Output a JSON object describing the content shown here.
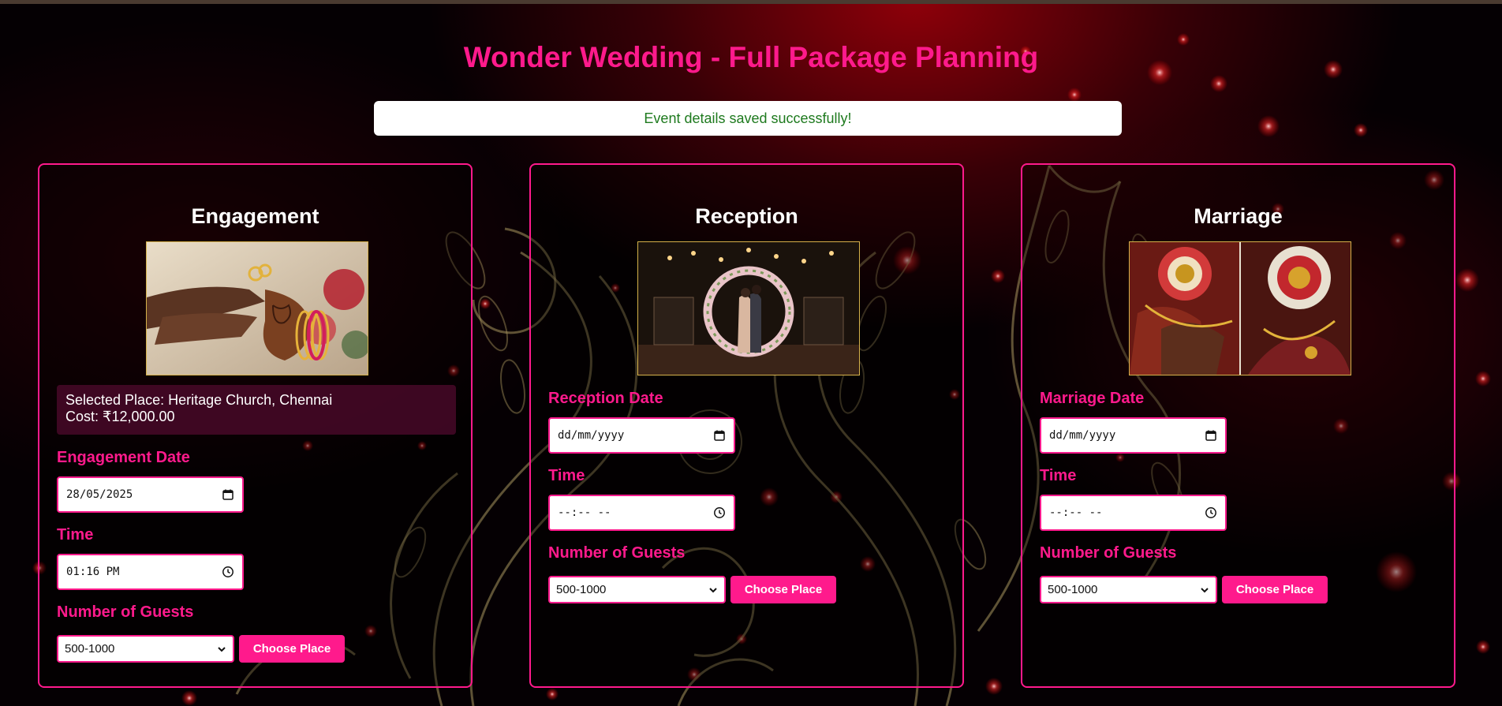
{
  "page": {
    "title": "Wonder Wedding - Full Package Planning",
    "status_message": "Event details saved successfully!"
  },
  "colors": {
    "accent": "#ff1a8c",
    "success_text": "#1e7a1e",
    "photo_border": "#d4b14a"
  },
  "icons": {
    "date_field": "calendar-icon",
    "time_field": "clock-icon",
    "select": "chevron-down-icon"
  },
  "events": [
    {
      "title": "Engagement",
      "selected_place": "Selected Place: Heritage Church, Chennai",
      "cost": "Cost: ₹12,000.00",
      "date_label": "Engagement Date",
      "date_value": "28/05/2025",
      "time_label": "Time",
      "time_value": "01:16 PM",
      "guests_label": "Number of Guests",
      "guests_value": "500-1000",
      "button_label": "Choose Place"
    },
    {
      "title": "Reception",
      "date_label": "Reception Date",
      "date_value": "dd/mm/yyyy",
      "time_label": "Time",
      "time_value": "--:-- --",
      "guests_label": "Number of Guests",
      "guests_value": "500-1000",
      "button_label": "Choose Place"
    },
    {
      "title": "Marriage",
      "date_label": "Marriage Date",
      "date_value": "dd/mm/yyyy",
      "time_label": "Time",
      "time_value": "--:-- --",
      "guests_label": "Number of Guests",
      "guests_value": "500-1000",
      "button_label": "Choose Place"
    }
  ]
}
